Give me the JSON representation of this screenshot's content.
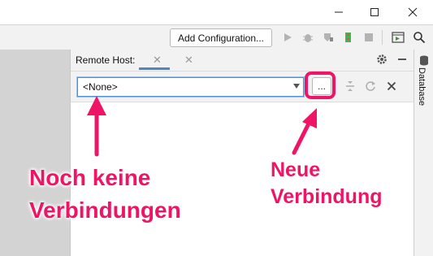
{
  "window": {
    "minimize_icon": "minimize-icon",
    "maximize_icon": "maximize-icon",
    "close_icon": "close-icon"
  },
  "toolbar": {
    "add_configuration_label": "Add Configuration...",
    "icons": [
      "run-icon",
      "debug-icon",
      "coverage-icon",
      "profile-icon",
      "stop-icon",
      "layout-icon",
      "search-icon"
    ]
  },
  "panel": {
    "title": "Remote Host:",
    "host_select_value": "<None>",
    "browse_label": "...",
    "side_label": "Database"
  },
  "annotations": {
    "left_line1": "Noch keine",
    "left_line2": "Verbindungen",
    "right_line1": "Neue",
    "right_line2": "Verbindung"
  },
  "colors": {
    "accent": "#ef1566",
    "focus": "#4f8fd6"
  }
}
